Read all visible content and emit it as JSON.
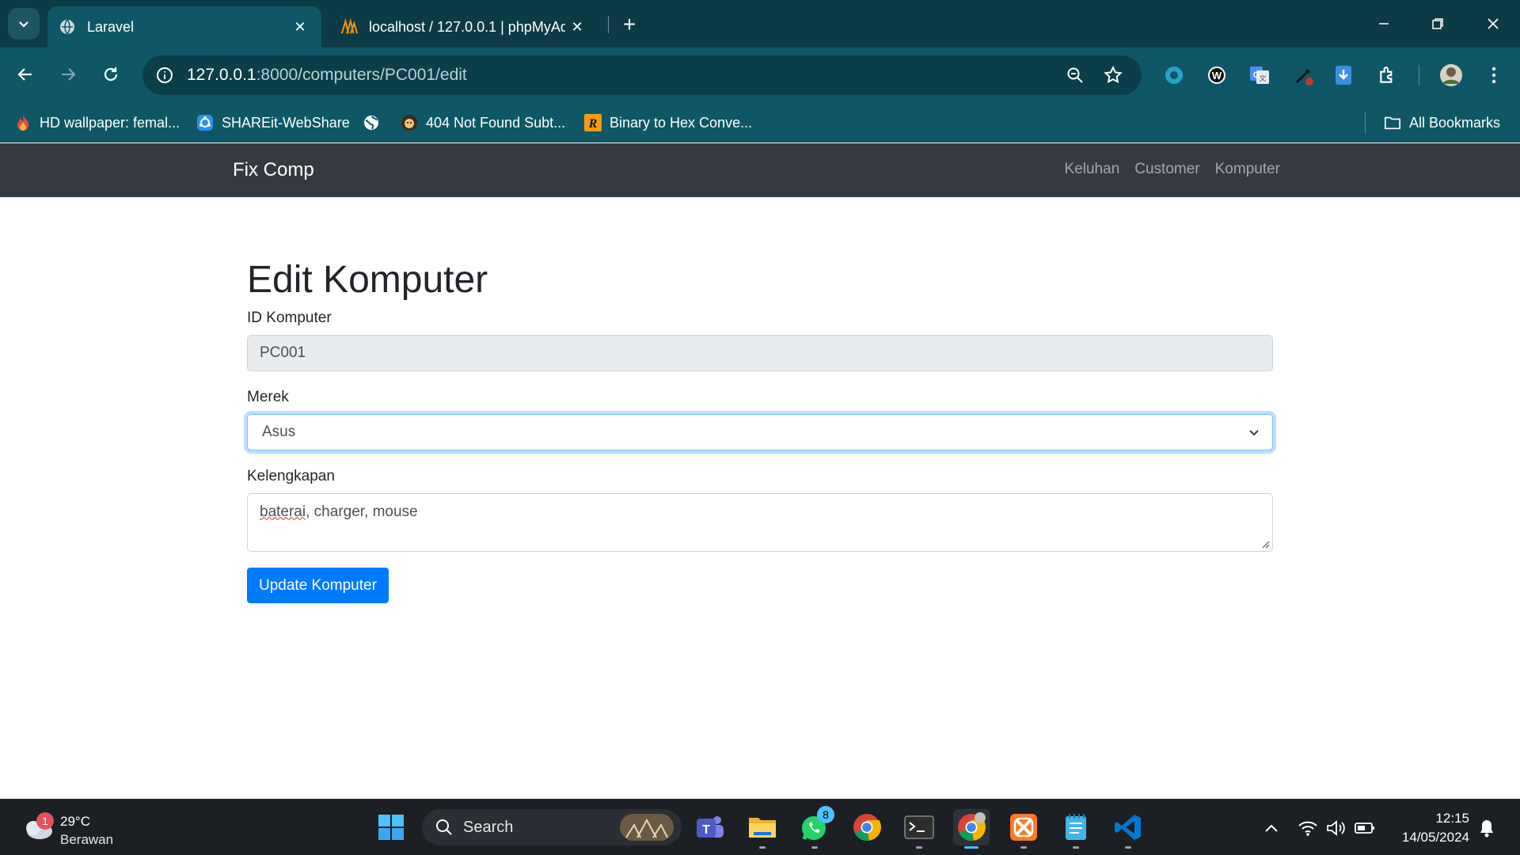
{
  "browser": {
    "tabs": [
      {
        "title": "Laravel",
        "active": true
      },
      {
        "title": "localhost / 127.0.0.1 | phpMyAd",
        "active": false
      }
    ],
    "url_host": "127.0.0.1",
    "url_rest": ":8000/computers/PC001/edit",
    "bookmarks": [
      {
        "label": "HD wallpaper: femal...",
        "icon": "flame-icon"
      },
      {
        "label": "SHAREit-WebShare",
        "icon": "shareit-icon"
      },
      {
        "label": "",
        "icon": "globe-icon"
      },
      {
        "label": "404 Not Found Subt...",
        "icon": "avatar-icon"
      },
      {
        "label": "Binary to Hex Conve...",
        "icon": "r-logo-icon"
      }
    ],
    "all_bookmarks": "All Bookmarks"
  },
  "app": {
    "brand": "Fix Comp",
    "nav": [
      "Keluhan",
      "Customer",
      "Komputer"
    ]
  },
  "form": {
    "title": "Edit Komputer",
    "id_label": "ID Komputer",
    "id_value": "PC001",
    "merek_label": "Merek",
    "merek_value": "Asus",
    "kelengkapan_label": "Kelengkapan",
    "kelengkapan_word1": "baterai",
    "kelengkapan_rest": ", charger, mouse",
    "submit": "Update Komputer"
  },
  "taskbar": {
    "weather_temp": "29°C",
    "weather_cond": "Berawan",
    "weather_badge": "1",
    "search": "Search",
    "whatsapp_badge": "8",
    "time": "12:15",
    "date": "14/05/2024"
  },
  "colors": {
    "tab_bar": "#0c3b45",
    "toolbar": "#0f5766",
    "navbar": "#343a40",
    "primary": "#007bff",
    "taskbar": "#1c1f24"
  }
}
